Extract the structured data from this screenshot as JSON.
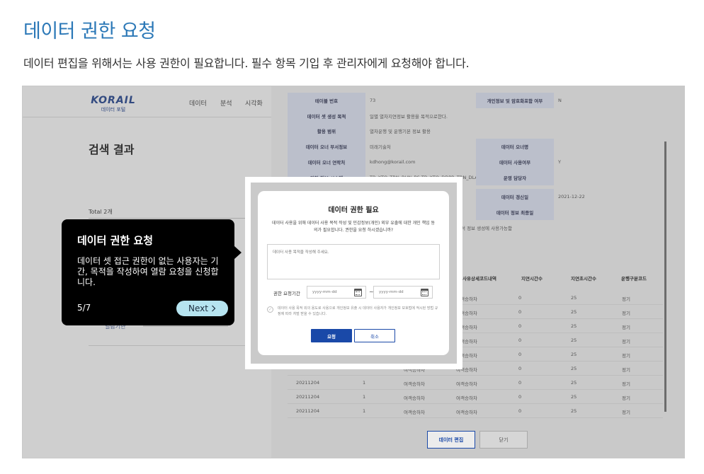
{
  "page": {
    "title": "데이터 권한 요청",
    "description": "데이터 편집을 위해서는 사용 권한이 필요합니다. 필수 항목 기입 후 관리자에게 요청해야 합니다."
  },
  "app": {
    "logo_main": "KORAIL",
    "logo_sub": "데이터 포털",
    "nav": [
      "데이터",
      "분석",
      "시각화"
    ],
    "search_title": "검색 결과",
    "total": "Total 2개",
    "bottom_left_link": "열람기한"
  },
  "info_table": [
    {
      "label": "테이블 번호",
      "value": "73",
      "label2": "개인정보 및 암호화포함 여부",
      "value2": "N"
    },
    {
      "label": "데이터 셋 생성 목적",
      "value": "일별 열차지연정보 활용을 목적으로한다.",
      "label2": "",
      "value2": ""
    },
    {
      "label": "활용 범위",
      "value": "열차운행 및 운행기본 정보 활용",
      "label2": "",
      "value2": ""
    },
    {
      "label": "데이터 오너 부서정보",
      "value": "미래기술처",
      "label2": "데이터 오너명",
      "value2": ""
    },
    {
      "label": "데이터 오너 연락처",
      "value": "kdhong@korail.com",
      "label2": "데이터 사용여부",
      "value2": "Y"
    },
    {
      "label": "원천 정보 시스템",
      "value": "TB_XTO_TRN_RUN_BS,TB_XTO_DDPR_TRN_DLA",
      "label2": "운영 담당자",
      "value2": ""
    },
    {
      "label": "",
      "value": "",
      "label2": "데이터 갱신일",
      "value2": "2021-12-22"
    },
    {
      "label": "",
      "value": "",
      "label2": "데이터 정보 최종일",
      "value2": ""
    }
  ],
  "info_note": "여 분석 정보 생성에 사용가능함",
  "data_table": {
    "headers": [
      "사유상세코드내역",
      "지연시간수",
      "지연초시간수",
      "운행구분코드"
    ],
    "rows": [
      [
        "",
        "",
        "여객승하차",
        "여객승하차",
        "0",
        "25",
        "정기"
      ],
      [
        "",
        "",
        "여객승하차",
        "여객승하차",
        "0",
        "25",
        "정기"
      ],
      [
        "",
        "",
        "여객승하차",
        "여객승하차",
        "0",
        "25",
        "정기"
      ],
      [
        "",
        "",
        "여객승하차",
        "여객승하차",
        "0",
        "25",
        "정기"
      ],
      [
        "20211204",
        "1",
        "여객승하차",
        "여객승하차",
        "0",
        "25",
        "정기"
      ],
      [
        "",
        "",
        "여객승하차",
        "여객승하차",
        "0",
        "25",
        "정기"
      ],
      [
        "20211204",
        "1",
        "여객승하차",
        "여객승하차",
        "0",
        "25",
        "정기"
      ],
      [
        "20211204",
        "1",
        "여객승하차",
        "여객승하차",
        "0",
        "25",
        "정기"
      ],
      [
        "20211204",
        "1",
        "여객승하차",
        "여객승하차",
        "0",
        "25",
        "정기"
      ]
    ],
    "edit_button": "데이터 편집",
    "close_button": "닫기"
  },
  "tooltip": {
    "title": "데이터 권한 요청",
    "body": "데이터 셋 접근 권한이 없는 사용자는 기간, 목적을 작성하여 열람 요청을 신청합니다.",
    "step": "5/7",
    "next_label": "Next",
    "next_icon": "chevron-right"
  },
  "modal": {
    "title": "데이터 권한 필요",
    "description": "데이터 사용을 위해 데이터 사용 목적 작성 및 민감정보(개인) 외부 유출에 대한 개인 책임 동의가 필요합니다. 권한을 요청 하시겠습니까?",
    "purpose_placeholder": "데이터 사용 목적을 작성해 주세요.",
    "period_label": "권한 요청기간",
    "date_from_placeholder": "yyyy-mm-dd",
    "date_to_placeholder": "yyyy-mm-dd",
    "date_separator": "~",
    "consent_text": "데이터 사용 목적 외의 용도로 사용으로 개인정보 유출 시 데이터 사용자가 개인정보 보호법에 적시된 방법 규정에 따라 처벌 받을 수 있습니다.",
    "request_button": "요청",
    "cancel_button": "취소"
  },
  "colors": {
    "title_blue": "#2b78b7",
    "primary_button": "#1a49a8",
    "next_button": "#b6e4f0"
  }
}
